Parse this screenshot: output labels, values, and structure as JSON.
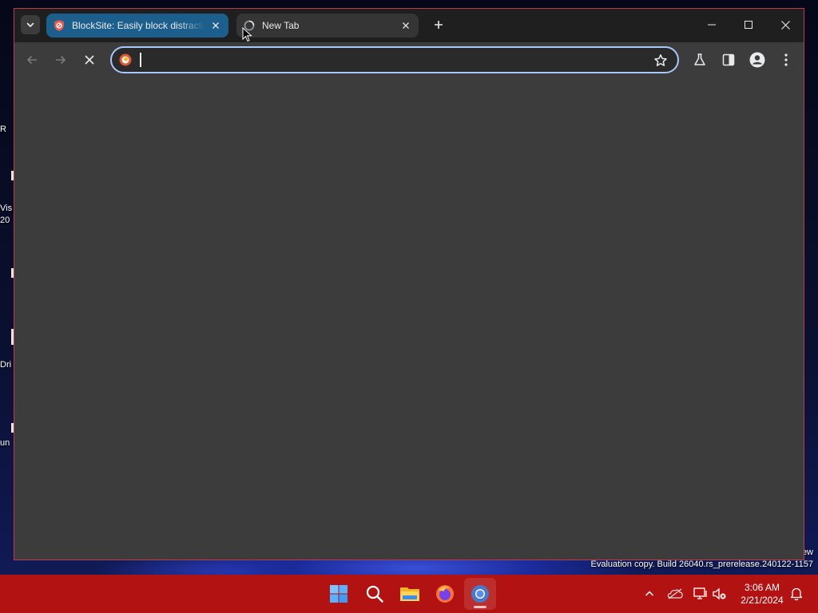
{
  "browser": {
    "tabs": [
      {
        "title": "BlockSite: Easily block distracting websites",
        "active": true,
        "favicon": "blocksite-shield-icon"
      },
      {
        "title": "New Tab",
        "active": false,
        "favicon": "loading-spinner-icon"
      }
    ],
    "omnibox": {
      "value": "",
      "placeholder": ""
    },
    "icons": {
      "tab_search": "chevron-down-icon",
      "new_tab": "plus-icon",
      "back": "arrow-left-icon",
      "forward": "arrow-right-icon",
      "stop": "close-icon",
      "bookmark": "star-icon",
      "labs": "flask-icon",
      "side_panel": "side-panel-icon",
      "profile": "person-icon",
      "menu": "vertical-dots-icon"
    },
    "accent_color": "#1d5f8c",
    "frame_color": "#1f1f1f",
    "content_color": "#3c3c3c"
  },
  "desktop": {
    "icon_labels": [
      "R",
      "Vis",
      "20",
      "Dri",
      "un"
    ],
    "watermark_fragment": "ew",
    "watermark": "Evaluation copy. Build 26040.rs_prerelease.240122-1157"
  },
  "taskbar": {
    "color": "#b31212",
    "apps": [
      "start-icon",
      "search-icon",
      "file-explorer-icon",
      "firefox-icon",
      "chrome-icon"
    ],
    "tray": [
      "chevron-up-icon",
      "onedrive-icon",
      "network-icon",
      "volume-muted-icon",
      "notification-bell-icon"
    ],
    "time": "3:06 AM",
    "date": "2/21/2024"
  }
}
